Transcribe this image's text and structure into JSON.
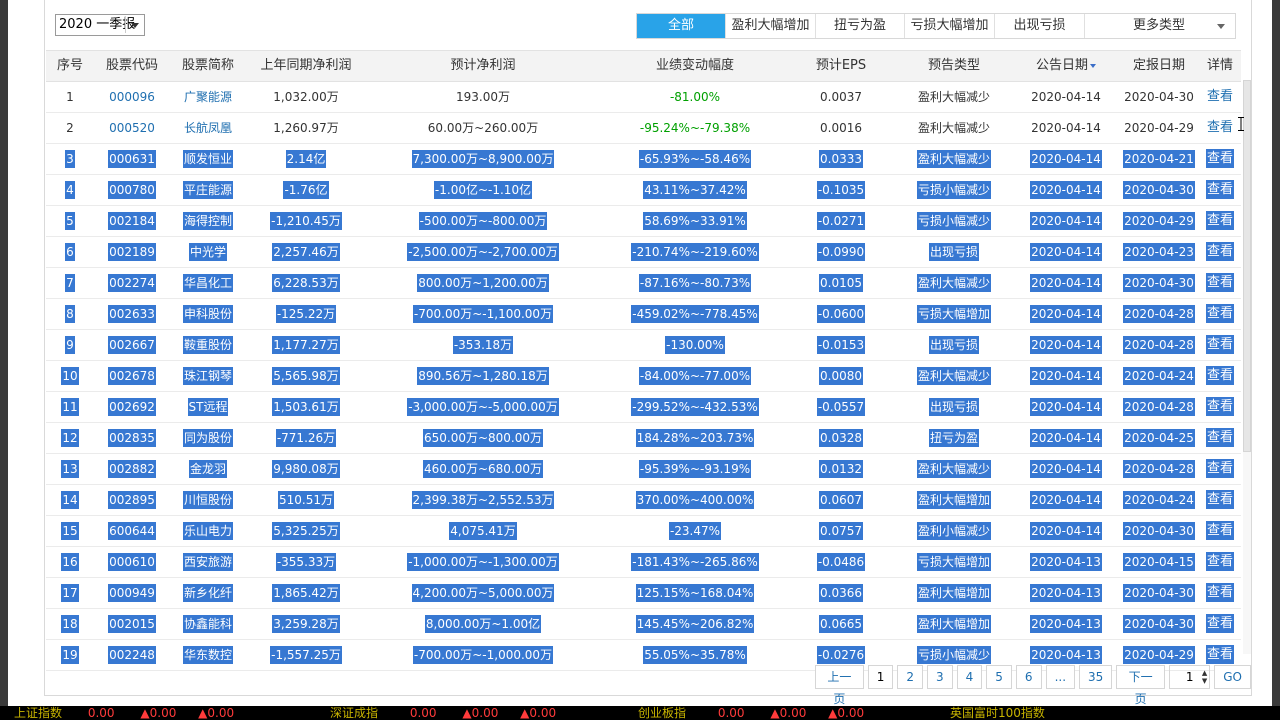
{
  "period_select": {
    "value": "2020 一季报"
  },
  "type_tabs": [
    {
      "label": "全部",
      "active": true
    },
    {
      "label": "盈利大幅增加",
      "active": false
    },
    {
      "label": "扭亏为盈",
      "active": false
    },
    {
      "label": "亏损大幅增加",
      "active": false
    },
    {
      "label": "出现亏损",
      "active": false
    },
    {
      "label": "更多类型",
      "active": false
    }
  ],
  "table": {
    "headers": [
      "序号",
      "股票代码",
      "股票简称",
      "上年同期净利润",
      "预计净利润",
      "业绩变动幅度",
      "预计EPS",
      "预告类型",
      "公告日期",
      "定报日期",
      "详情"
    ],
    "rows": [
      {
        "no": "1",
        "code": "000096",
        "name": "广聚能源",
        "prev": "1,032.00万",
        "est": "193.00万",
        "chg": "-81.00%",
        "eps": "0.0037",
        "type": "盈利大幅减少",
        "ann": "2020-04-14",
        "rep": "2020-04-30",
        "detail": "查看",
        "sel": false
      },
      {
        "no": "2",
        "code": "000520",
        "name": "长航凤凰",
        "prev": "1,260.97万",
        "est": "60.00万~260.00万",
        "chg": "-95.24%~-79.38%",
        "eps": "0.0016",
        "type": "盈利大幅减少",
        "ann": "2020-04-14",
        "rep": "2020-04-29",
        "detail": "查看",
        "sel": false
      },
      {
        "no": "3",
        "code": "000631",
        "name": "顺发恒业",
        "prev": "2.14亿",
        "est": "7,300.00万~8,900.00万",
        "chg": "-65.93%~-58.46%",
        "eps": "0.0333",
        "type": "盈利大幅减少",
        "ann": "2020-04-14",
        "rep": "2020-04-21",
        "detail": "查看",
        "sel": true
      },
      {
        "no": "4",
        "code": "000780",
        "name": "平庄能源",
        "prev": "-1.76亿",
        "est": "-1.00亿~-1.10亿",
        "chg": "43.11%~37.42%",
        "eps": "-0.1035",
        "type": "亏损小幅减少",
        "ann": "2020-04-14",
        "rep": "2020-04-30",
        "detail": "查看",
        "sel": true
      },
      {
        "no": "5",
        "code": "002184",
        "name": "海得控制",
        "prev": "-1,210.45万",
        "est": "-500.00万~-800.00万",
        "chg": "58.69%~33.91%",
        "eps": "-0.0271",
        "type": "亏损小幅减少",
        "ann": "2020-04-14",
        "rep": "2020-04-29",
        "detail": "查看",
        "sel": true
      },
      {
        "no": "6",
        "code": "002189",
        "name": "中光学",
        "prev": "2,257.46万",
        "est": "-2,500.00万~-2,700.00万",
        "chg": "-210.74%~-219.60%",
        "eps": "-0.0990",
        "type": "出现亏损",
        "ann": "2020-04-14",
        "rep": "2020-04-23",
        "detail": "查看",
        "sel": true
      },
      {
        "no": "7",
        "code": "002274",
        "name": "华昌化工",
        "prev": "6,228.53万",
        "est": "800.00万~1,200.00万",
        "chg": "-87.16%~-80.73%",
        "eps": "0.0105",
        "type": "盈利大幅减少",
        "ann": "2020-04-14",
        "rep": "2020-04-30",
        "detail": "查看",
        "sel": true
      },
      {
        "no": "8",
        "code": "002633",
        "name": "申科股份",
        "prev": "-125.22万",
        "est": "-700.00万~-1,100.00万",
        "chg": "-459.02%~-778.45%",
        "eps": "-0.0600",
        "type": "亏损大幅增加",
        "ann": "2020-04-14",
        "rep": "2020-04-28",
        "detail": "查看",
        "sel": true
      },
      {
        "no": "9",
        "code": "002667",
        "name": "鞍重股份",
        "prev": "1,177.27万",
        "est": "-353.18万",
        "chg": "-130.00%",
        "eps": "-0.0153",
        "type": "出现亏损",
        "ann": "2020-04-14",
        "rep": "2020-04-28",
        "detail": "查看",
        "sel": true
      },
      {
        "no": "10",
        "code": "002678",
        "name": "珠江钢琴",
        "prev": "5,565.98万",
        "est": "890.56万~1,280.18万",
        "chg": "-84.00%~-77.00%",
        "eps": "0.0080",
        "type": "盈利大幅减少",
        "ann": "2020-04-14",
        "rep": "2020-04-24",
        "detail": "查看",
        "sel": true
      },
      {
        "no": "11",
        "code": "002692",
        "name": "ST远程",
        "prev": "1,503.61万",
        "est": "-3,000.00万~-5,000.00万",
        "chg": "-299.52%~-432.53%",
        "eps": "-0.0557",
        "type": "出现亏损",
        "ann": "2020-04-14",
        "rep": "2020-04-28",
        "detail": "查看",
        "sel": true
      },
      {
        "no": "12",
        "code": "002835",
        "name": "同为股份",
        "prev": "-771.26万",
        "est": "650.00万~800.00万",
        "chg": "184.28%~203.73%",
        "eps": "0.0328",
        "type": "扭亏为盈",
        "ann": "2020-04-14",
        "rep": "2020-04-25",
        "detail": "查看",
        "sel": true
      },
      {
        "no": "13",
        "code": "002882",
        "name": "金龙羽",
        "prev": "9,980.08万",
        "est": "460.00万~680.00万",
        "chg": "-95.39%~-93.19%",
        "eps": "0.0132",
        "type": "盈利大幅减少",
        "ann": "2020-04-14",
        "rep": "2020-04-28",
        "detail": "查看",
        "sel": true
      },
      {
        "no": "14",
        "code": "002895",
        "name": "川恒股份",
        "prev": "510.51万",
        "est": "2,399.38万~2,552.53万",
        "chg": "370.00%~400.00%",
        "eps": "0.0607",
        "type": "盈利大幅增加",
        "ann": "2020-04-14",
        "rep": "2020-04-24",
        "detail": "查看",
        "sel": true
      },
      {
        "no": "15",
        "code": "600644",
        "name": "乐山电力",
        "prev": "5,325.25万",
        "est": "4,075.41万",
        "chg": "-23.47%",
        "eps": "0.0757",
        "type": "盈利小幅减少",
        "ann": "2020-04-14",
        "rep": "2020-04-30",
        "detail": "查看",
        "sel": true
      },
      {
        "no": "16",
        "code": "000610",
        "name": "西安旅游",
        "prev": "-355.33万",
        "est": "-1,000.00万~-1,300.00万",
        "chg": "-181.43%~-265.86%",
        "eps": "-0.0486",
        "type": "亏损大幅增加",
        "ann": "2020-04-13",
        "rep": "2020-04-15",
        "detail": "查看",
        "sel": true
      },
      {
        "no": "17",
        "code": "000949",
        "name": "新乡化纤",
        "prev": "1,865.42万",
        "est": "4,200.00万~5,000.00万",
        "chg": "125.15%~168.04%",
        "eps": "0.0366",
        "type": "盈利大幅增加",
        "ann": "2020-04-13",
        "rep": "2020-04-30",
        "detail": "查看",
        "sel": true
      },
      {
        "no": "18",
        "code": "002015",
        "name": "协鑫能科",
        "prev": "3,259.28万",
        "est": "8,000.00万~1.00亿",
        "chg": "145.45%~206.82%",
        "eps": "0.0665",
        "type": "盈利大幅增加",
        "ann": "2020-04-13",
        "rep": "2020-04-30",
        "detail": "查看",
        "sel": true
      },
      {
        "no": "19",
        "code": "002248",
        "name": "华东数控",
        "prev": "-1,557.25万",
        "est": "-700.00万~-1,000.00万",
        "chg": "55.05%~35.78%",
        "eps": "-0.0276",
        "type": "亏损小幅减少",
        "ann": "2020-04-13",
        "rep": "2020-04-29",
        "detail": "查看",
        "sel": true
      }
    ]
  },
  "pager": {
    "prev": "上一页",
    "pages": [
      "1",
      "2",
      "3",
      "4",
      "5",
      "6",
      "...",
      "35"
    ],
    "current": "1",
    "next": "下一页",
    "input_value": "1",
    "go": "GO"
  },
  "ticker": [
    {
      "name": "上证指数",
      "value": "0.00",
      "chg1": "▲0.00",
      "chg2": "▲0.00"
    },
    {
      "name": "深证成指",
      "value": "0.00",
      "chg1": "▲0.00",
      "chg2": "▲0.00"
    },
    {
      "name": "创业板指",
      "value": "0.00",
      "chg1": "▲0.00",
      "chg2": "▲0.00"
    },
    {
      "name": "英国富时100指数",
      "value": "",
      "chg1": "",
      "chg2": ""
    }
  ],
  "colors": {
    "accent": "#29a3e8",
    "selection": "#3778d2",
    "link": "#1f6fb0",
    "down": "#00a000",
    "up": "#e00000"
  }
}
